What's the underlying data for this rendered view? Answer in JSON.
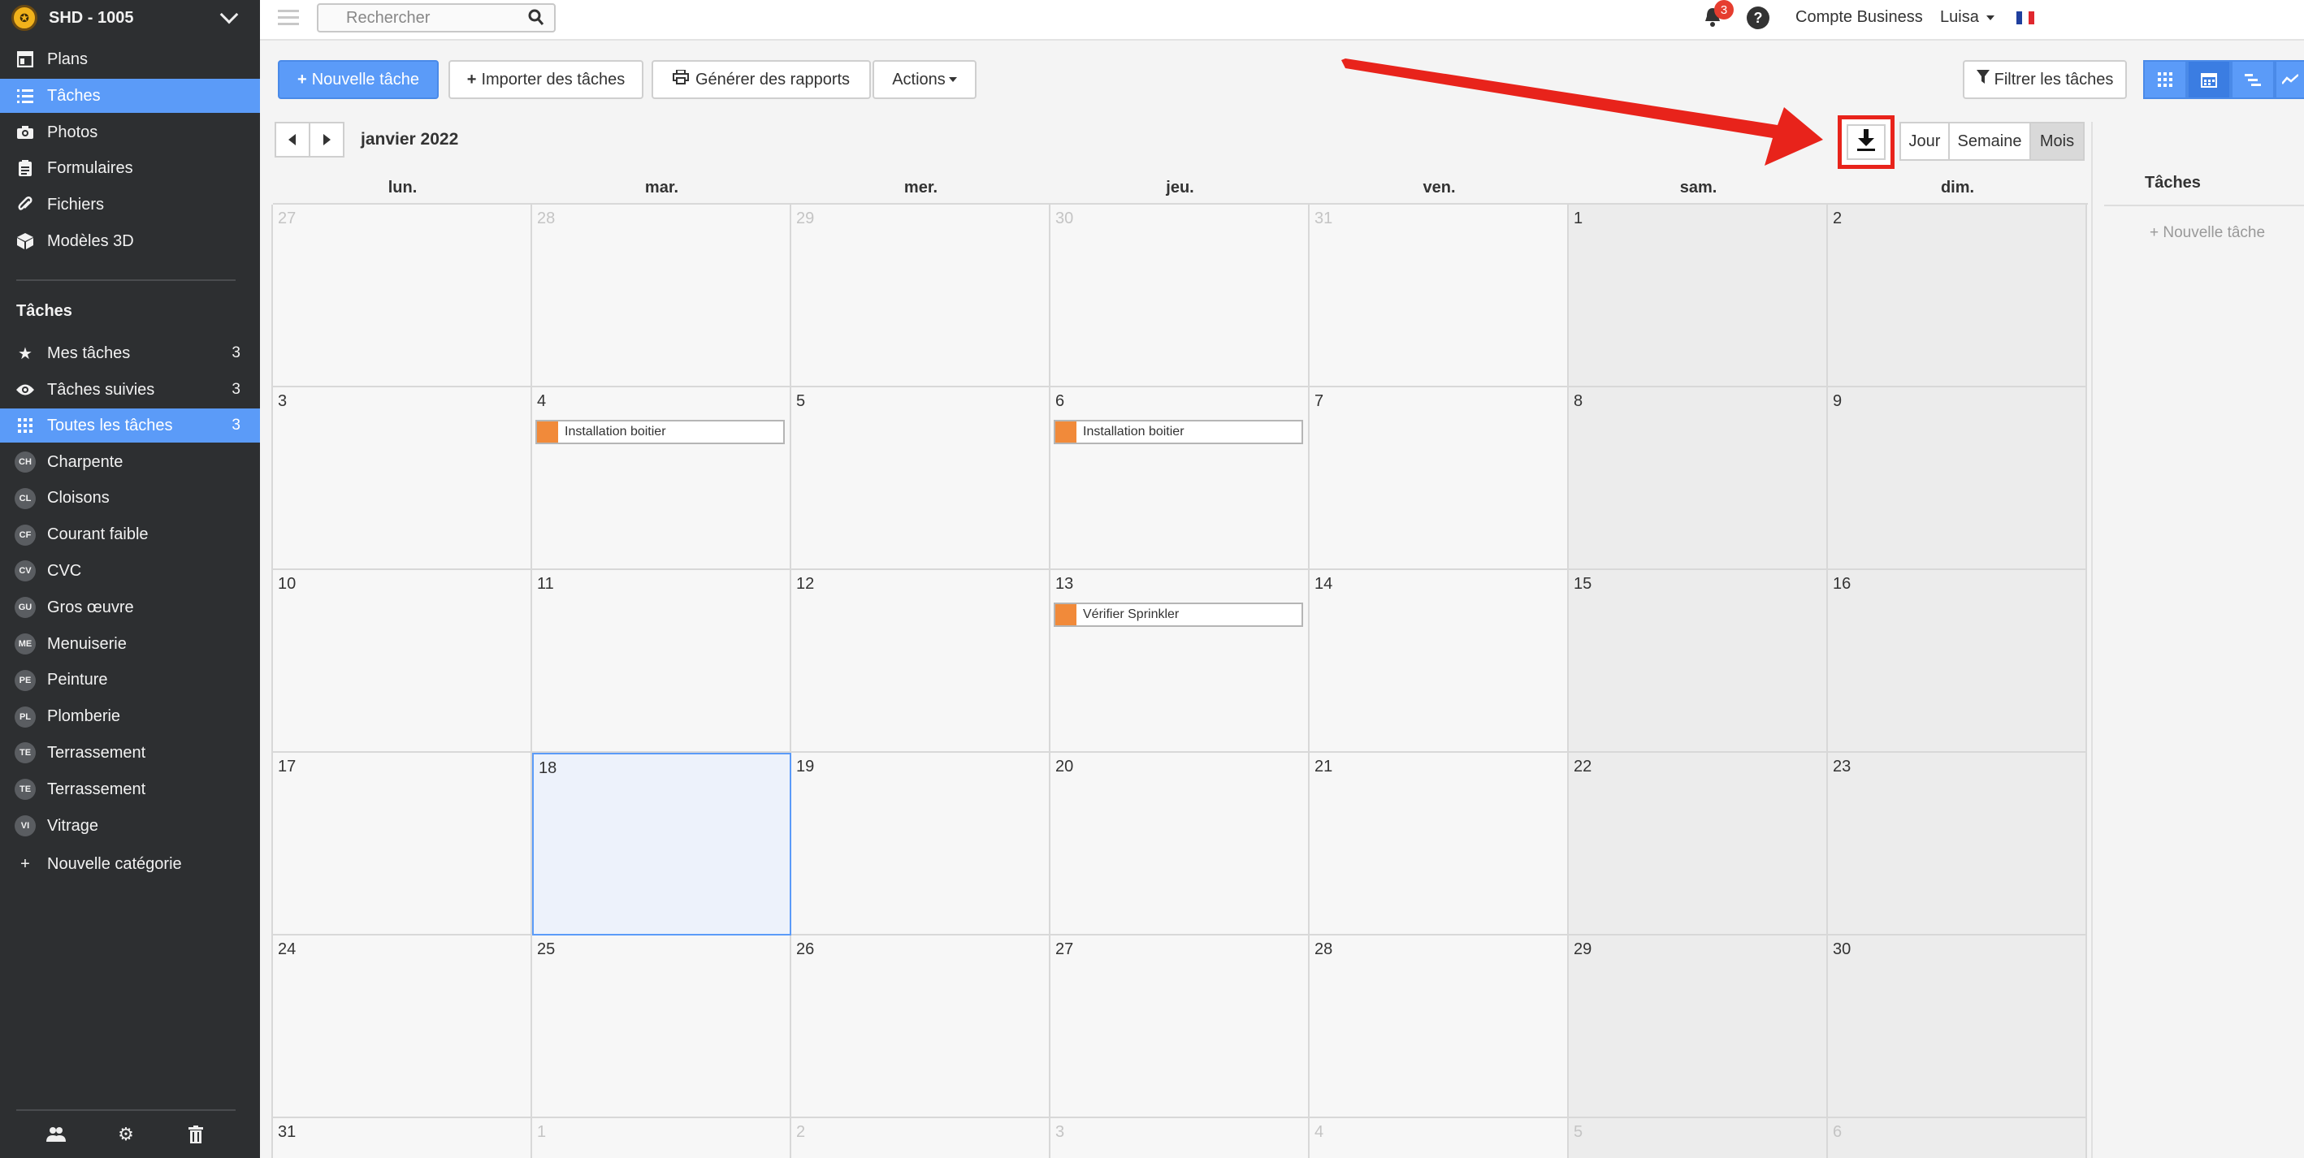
{
  "sidebar": {
    "project": "SHD - 1005",
    "nav": [
      {
        "label": "Plans",
        "icon": "plan-icon"
      },
      {
        "label": "Tâches",
        "icon": "list-icon"
      },
      {
        "label": "Photos",
        "icon": "camera-icon"
      },
      {
        "label": "Formulaires",
        "icon": "clipboard-icon"
      },
      {
        "label": "Fichiers",
        "icon": "paperclip-icon"
      },
      {
        "label": "Modèles 3D",
        "icon": "cube-icon"
      }
    ],
    "tasks_header": "Tâches",
    "task_filters": [
      {
        "label": "Mes tâches",
        "count": "3",
        "icon": "star-icon"
      },
      {
        "label": "Tâches suivies",
        "count": "3",
        "icon": "eye-icon"
      },
      {
        "label": "Toutes les tâches",
        "count": "3",
        "icon": "grid-icon"
      }
    ],
    "categories": [
      {
        "abbr": "CH",
        "label": "Charpente"
      },
      {
        "abbr": "CL",
        "label": "Cloisons"
      },
      {
        "abbr": "CF",
        "label": "Courant faible"
      },
      {
        "abbr": "CV",
        "label": "CVC"
      },
      {
        "abbr": "GU",
        "label": "Gros œuvre"
      },
      {
        "abbr": "ME",
        "label": "Menuiserie"
      },
      {
        "abbr": "PE",
        "label": "Peinture"
      },
      {
        "abbr": "PL",
        "label": "Plomberie"
      },
      {
        "abbr": "TE",
        "label": "Terrassement"
      },
      {
        "abbr": "TE",
        "label": "Terrassement"
      },
      {
        "abbr": "VI",
        "label": "Vitrage"
      }
    ],
    "new_category": "Nouvelle catégorie"
  },
  "topbar": {
    "search_placeholder": "Rechercher",
    "notification_count": "3",
    "help": "?",
    "account": "Compte Business",
    "user": "Luisa"
  },
  "toolbar": {
    "new_task": "Nouvelle tâche",
    "import": "Importer des tâches",
    "reports": "Générer des rapports",
    "actions": "Actions",
    "filter": "Filtrer les tâches"
  },
  "calendar": {
    "month": "janvier 2022",
    "range_buttons": [
      "Jour",
      "Semaine",
      "Mois"
    ],
    "active_range": "Mois",
    "weekdays": [
      "lun.",
      "mar.",
      "mer.",
      "jeu.",
      "ven.",
      "sam.",
      "dim."
    ],
    "weeks": [
      [
        {
          "d": "27",
          "o": true
        },
        {
          "d": "28",
          "o": true
        },
        {
          "d": "29",
          "o": true
        },
        {
          "d": "30",
          "o": true
        },
        {
          "d": "31",
          "o": true
        },
        {
          "d": "1"
        },
        {
          "d": "2"
        }
      ],
      [
        {
          "d": "3"
        },
        {
          "d": "4",
          "e": "Installation boitier"
        },
        {
          "d": "5"
        },
        {
          "d": "6",
          "e": "Installation boitier"
        },
        {
          "d": "7"
        },
        {
          "d": "8"
        },
        {
          "d": "9"
        }
      ],
      [
        {
          "d": "10"
        },
        {
          "d": "11"
        },
        {
          "d": "12"
        },
        {
          "d": "13",
          "e": "Vérifier Sprinkler"
        },
        {
          "d": "14"
        },
        {
          "d": "15"
        },
        {
          "d": "16"
        }
      ],
      [
        {
          "d": "17"
        },
        {
          "d": "18",
          "t": true
        },
        {
          "d": "19"
        },
        {
          "d": "20"
        },
        {
          "d": "21"
        },
        {
          "d": "22"
        },
        {
          "d": "23"
        }
      ],
      [
        {
          "d": "24"
        },
        {
          "d": "25"
        },
        {
          "d": "26"
        },
        {
          "d": "27"
        },
        {
          "d": "28"
        },
        {
          "d": "29"
        },
        {
          "d": "30"
        }
      ],
      [
        {
          "d": "31"
        },
        {
          "d": "1",
          "o": true
        },
        {
          "d": "2",
          "o": true
        },
        {
          "d": "3",
          "o": true
        },
        {
          "d": "4",
          "o": true
        },
        {
          "d": "5",
          "o": true
        },
        {
          "d": "6",
          "o": true
        }
      ]
    ]
  },
  "right_panel": {
    "title": "Tâches",
    "new_task": "+ Nouvelle tâche"
  },
  "colors": {
    "accent": "#5b9bf8",
    "event": "#f18a3a",
    "highlight": "#e8231b"
  }
}
